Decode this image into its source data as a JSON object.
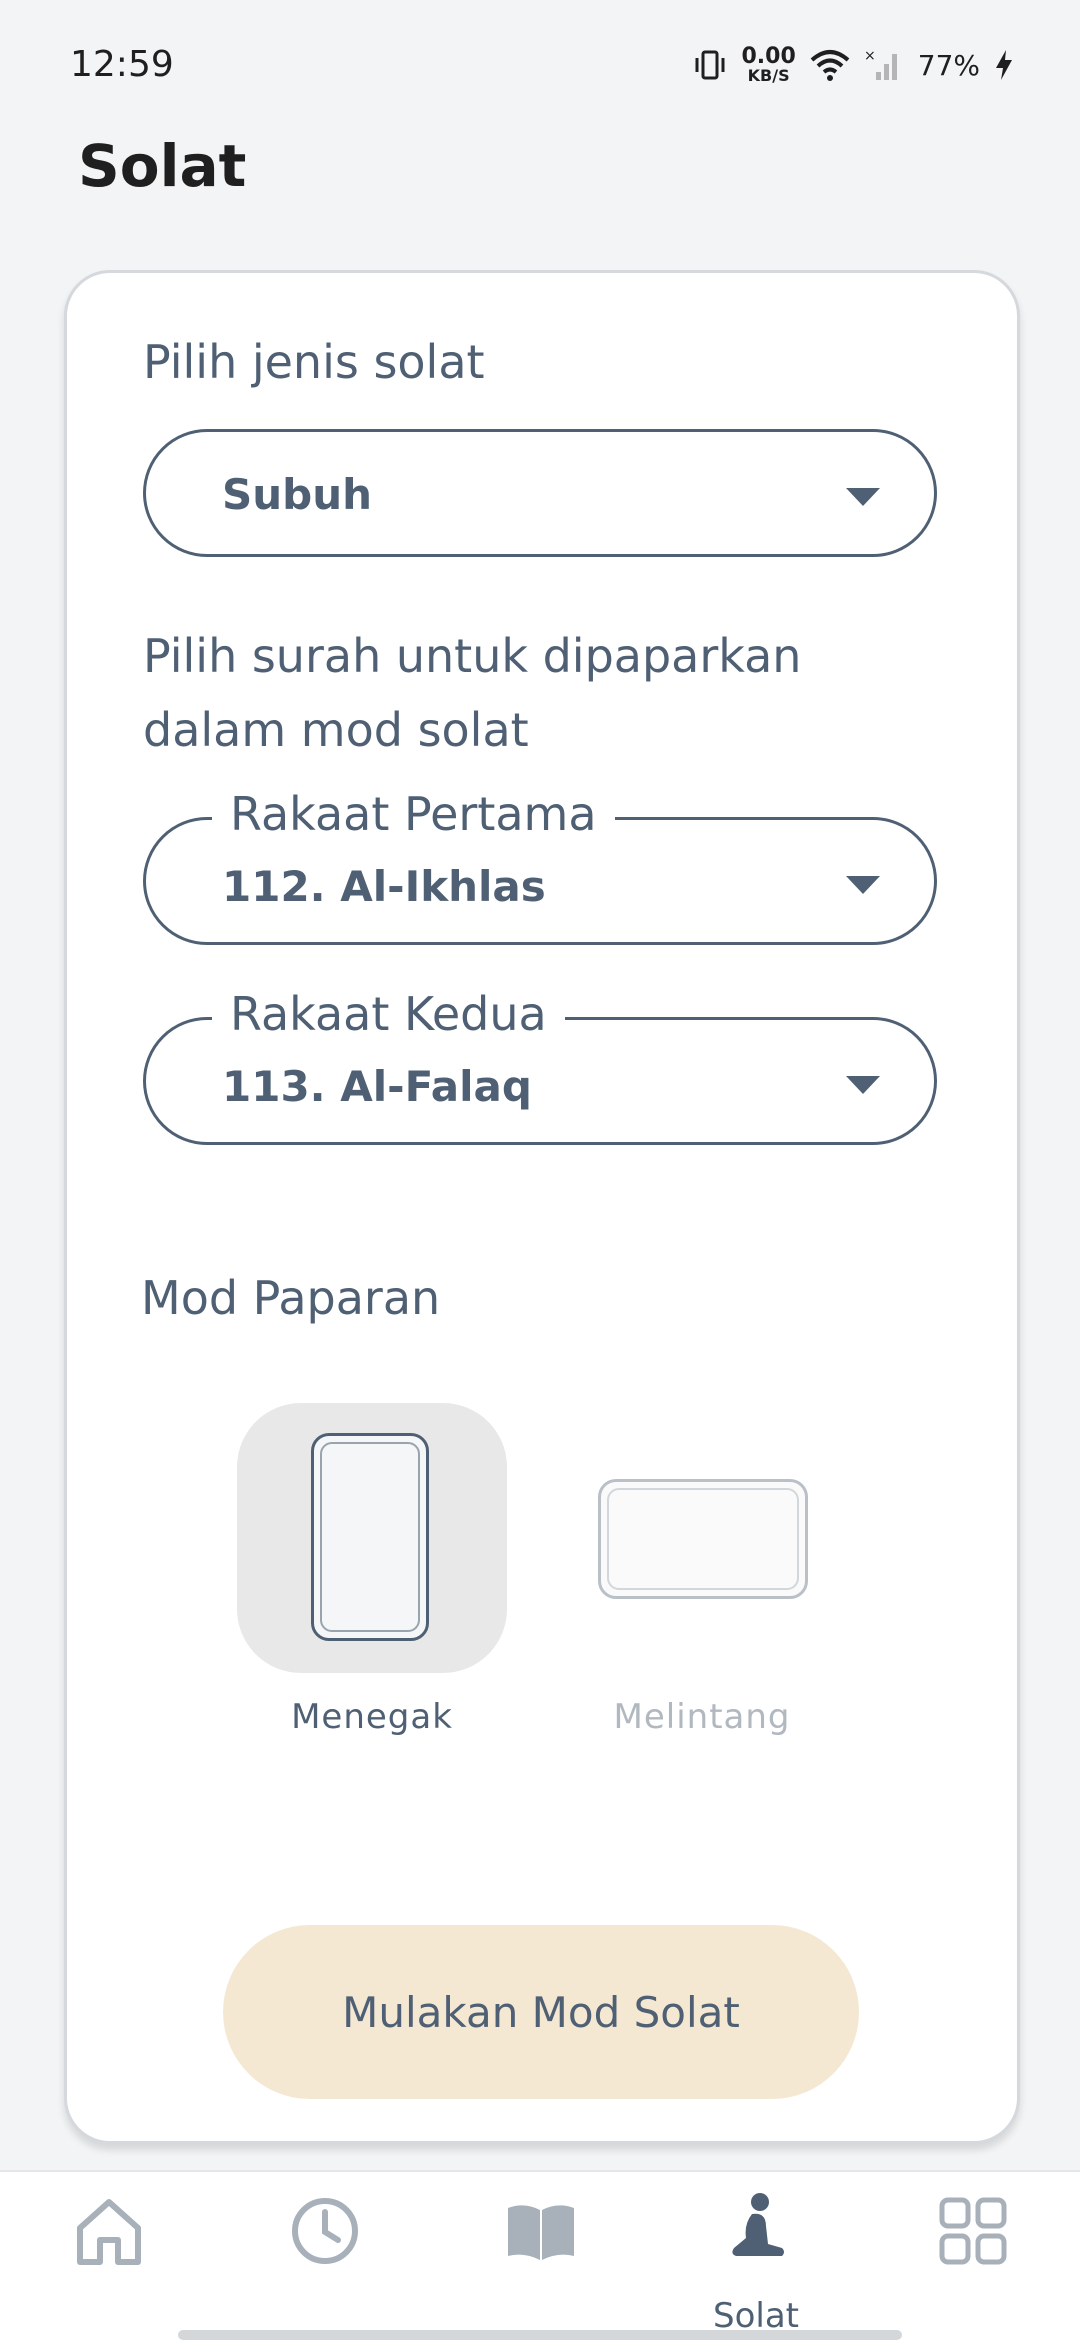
{
  "status_bar": {
    "time": "12:59",
    "net_speed_value": "0.00",
    "net_speed_unit": "KB/S",
    "battery": "77%",
    "icons": [
      "vibrate-icon",
      "wifi-icon",
      "signal-icon",
      "charging-icon"
    ]
  },
  "page": {
    "title": "Solat"
  },
  "form": {
    "prayer_type_label": "Pilih jenis solat",
    "prayer_type_value": "Subuh",
    "surah_label_line1": "Pilih surah untuk dipaparkan",
    "surah_label_line2": "dalam mod solat",
    "first_rakaat_label": "Rakaat Pertama",
    "first_rakaat_value": "112. Al-Ikhlas",
    "second_rakaat_label": "Rakaat Kedua",
    "second_rakaat_value": "113. Al-Falaq"
  },
  "display_mode": {
    "label": "Mod Paparan",
    "options": [
      {
        "label": "Menegak",
        "selected": true
      },
      {
        "label": "Melintang",
        "selected": false
      }
    ]
  },
  "start_button": {
    "label": "Mulakan Mod Solat",
    "color": "#f4e8d3"
  },
  "bottom_nav": {
    "items": [
      {
        "icon": "home-icon",
        "label": ""
      },
      {
        "icon": "clock-icon",
        "label": ""
      },
      {
        "icon": "book-icon",
        "label": ""
      },
      {
        "icon": "prayer-icon",
        "label": "Solat",
        "active": true
      },
      {
        "icon": "grid-icon",
        "label": ""
      }
    ]
  },
  "colors": {
    "accent": "#4f6074",
    "background": "#f2f4f6",
    "card": "#ffffff"
  }
}
